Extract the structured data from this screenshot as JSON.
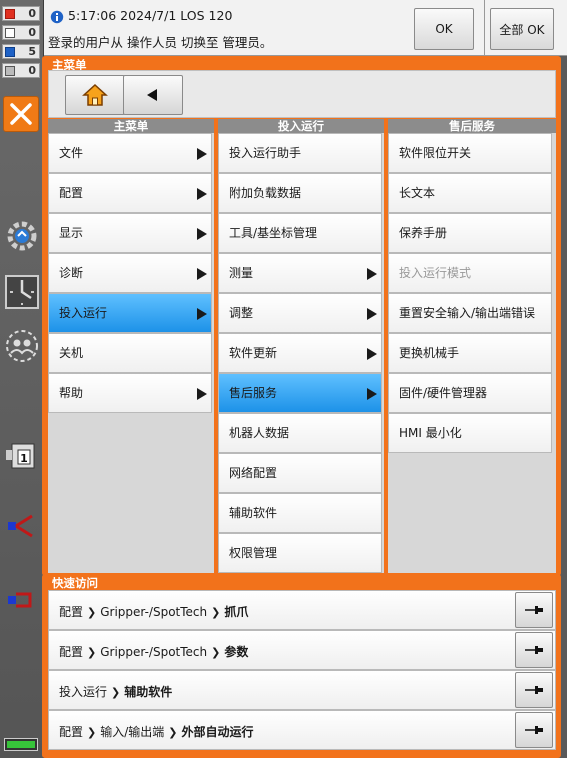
{
  "status_counters": [
    {
      "icon": "error-icon",
      "value": "0"
    },
    {
      "icon": "warning-icon",
      "value": "0"
    },
    {
      "icon": "info-icon",
      "value": "5"
    },
    {
      "icon": "wait-icon",
      "value": "0"
    }
  ],
  "message": {
    "line1": "5:17:06 2024/7/1 LOS 120",
    "line2": "登录的用户从 操作人员 切换至 管理员。",
    "ok_label": "OK",
    "ok_all_label": "全部 OK"
  },
  "main_menu": {
    "title": "主菜单",
    "headers": [
      "主菜单",
      "投入运行",
      "售后服务"
    ],
    "col1": [
      {
        "label": "文件",
        "arrow": true
      },
      {
        "label": "配置",
        "arrow": true
      },
      {
        "label": "显示",
        "arrow": true
      },
      {
        "label": "诊断",
        "arrow": true
      },
      {
        "label": "投入运行",
        "arrow": true,
        "selected": true
      },
      {
        "label": "关机",
        "arrow": false
      },
      {
        "label": "帮助",
        "arrow": true
      }
    ],
    "col2": [
      {
        "label": "投入运行助手",
        "arrow": false
      },
      {
        "label": "附加负载数据",
        "arrow": false
      },
      {
        "label": "工具/基坐标管理",
        "arrow": false
      },
      {
        "label": "测量",
        "arrow": true
      },
      {
        "label": "调整",
        "arrow": true
      },
      {
        "label": "软件更新",
        "arrow": true
      },
      {
        "label": "售后服务",
        "arrow": true,
        "selected": true
      },
      {
        "label": "机器人数据",
        "arrow": false
      },
      {
        "label": "网络配置",
        "arrow": false
      },
      {
        "label": "辅助软件",
        "arrow": false
      },
      {
        "label": "权限管理",
        "arrow": false
      }
    ],
    "col3": [
      {
        "label": "软件限位开关",
        "arrow": false
      },
      {
        "label": "长文本",
        "arrow": false
      },
      {
        "label": "保养手册",
        "arrow": false
      },
      {
        "label": "投入运行模式",
        "arrow": false,
        "disabled": true
      },
      {
        "label": "重置安全输入/输出端错误",
        "arrow": false
      },
      {
        "label": "更换机械手",
        "arrow": false
      },
      {
        "label": "固件/硬件管理器",
        "arrow": false
      },
      {
        "label": "HMI 最小化",
        "arrow": false
      }
    ]
  },
  "quick_access": {
    "title": "快速访问",
    "rows": [
      {
        "path": [
          "配置",
          "Gripper-/SpotTech"
        ],
        "last": "抓爪"
      },
      {
        "path": [
          "配置",
          "Gripper-/SpotTech"
        ],
        "last": "参数"
      },
      {
        "path": [
          "投入运行"
        ],
        "last": "辅助软件"
      },
      {
        "path": [
          "配置",
          "输入/输出端"
        ],
        "last": "外部自动运行"
      }
    ]
  },
  "colors": {
    "accent_orange": "#f2721b",
    "selected_blue": "#1d92e8",
    "rail_grey": "#5a5a5a"
  }
}
